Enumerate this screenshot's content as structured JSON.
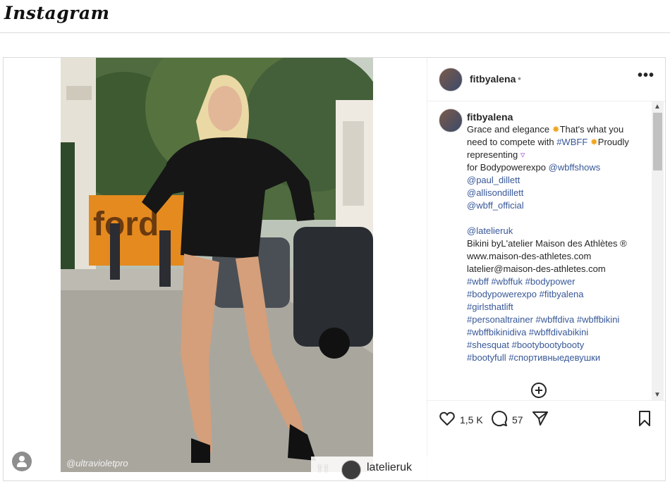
{
  "app": {
    "logo_text": "Instagram"
  },
  "post": {
    "author": "fitbyalena",
    "header_dot": "•",
    "more_label": "•••",
    "caption_author": "fitbyalena",
    "caption_lines": [
      [
        {
          "t": "Grace and elegance "
        },
        {
          "t": "✸",
          "c": "star"
        },
        {
          "t": "That's what you"
        }
      ],
      [
        {
          "t": "need to compete with "
        },
        {
          "t": "#WBFF",
          "c": "link"
        },
        {
          "t": " "
        },
        {
          "t": "✸",
          "c": "star"
        },
        {
          "t": "Proudly"
        }
      ],
      [
        {
          "t": "representing "
        },
        {
          "t": "▿",
          "c": "purple"
        }
      ],
      [
        {
          "t": "for Bodypowerexpo "
        },
        {
          "t": "@wbffshows",
          "c": "link"
        }
      ],
      [
        {
          "t": "@paul_dillett",
          "c": "link"
        }
      ],
      [
        {
          "t": "@allisondillett",
          "c": "link"
        }
      ],
      [
        {
          "t": "@wbff_official",
          "c": "link"
        }
      ],
      [
        {
          "t": ""
        }
      ],
      [
        {
          "t": "@latelieruk",
          "c": "link"
        }
      ],
      [
        {
          "t": "Bikini byL'atelier Maison des Athlètes ®"
        }
      ],
      [
        {
          "t": "www.maison-des-athletes.com"
        }
      ],
      [
        {
          "t": "latelier@maison-des-athletes.com"
        }
      ],
      [
        {
          "t": "#wbff #wbffuk #bodypower",
          "c": "link"
        }
      ],
      [
        {
          "t": "#bodypowerexpo #fitbyalena",
          "c": "link"
        }
      ],
      [
        {
          "t": "#girlsthatlift",
          "c": "link"
        }
      ],
      [
        {
          "t": "#personaltrainer #wbffdiva #wbffbikini",
          "c": "link"
        }
      ],
      [
        {
          "t": "#wbffbikinidiva #wbffdivabikini",
          "c": "link"
        }
      ],
      [
        {
          "t": "#shesquat #bootybootybooty",
          "c": "link"
        }
      ],
      [
        {
          "t": "#bootyfull #спортивныедевушки",
          "c": "link"
        }
      ]
    ],
    "likes": "1,5 K",
    "comments_count": "57",
    "watermark": "@ultravioletpro",
    "tagged_user": "latelieruk",
    "tag_arrow": "↑↑",
    "photo_sign": "ford"
  },
  "colors": {
    "link": "#385898",
    "border": "#dbdbdb",
    "text": "#262626"
  }
}
